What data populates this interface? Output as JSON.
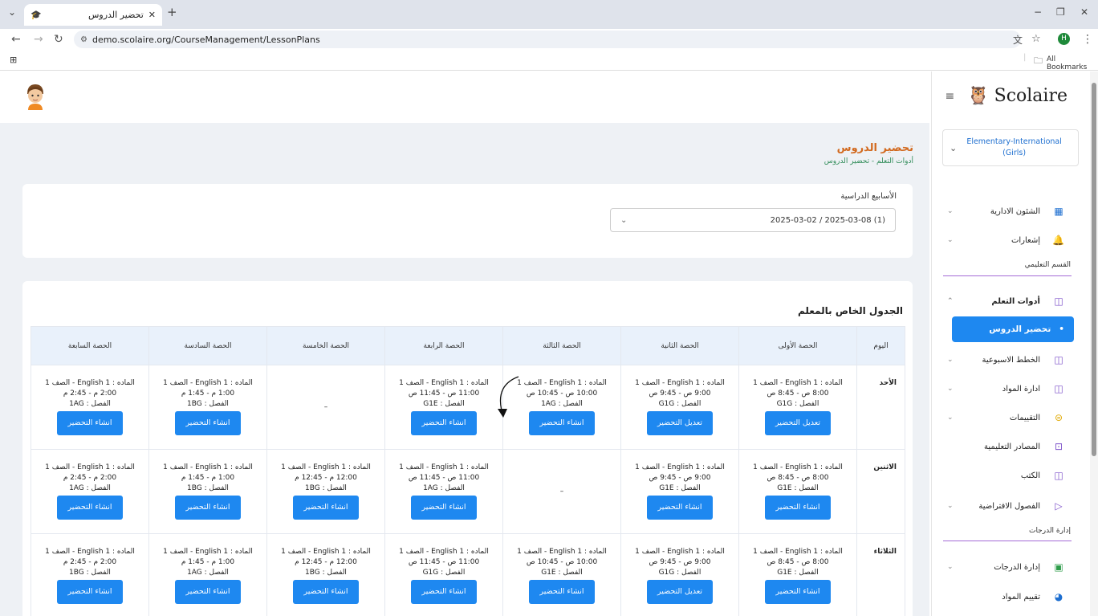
{
  "browser": {
    "tab_title": "تحضير الدروس",
    "url": "demo.scolaire.org/CourseManagement/LessonPlans",
    "all_bookmarks": "All Bookmarks",
    "profile_letter": "H"
  },
  "page": {
    "title": "تحضير الدروس",
    "breadcrumb": "أدوات التعلم  -  تحضير الدروس"
  },
  "weeks": {
    "label": "الأسابيع الدراسية",
    "selected": "(1) 2025-03-08 / 2025-03-02"
  },
  "schedule": {
    "title": "الجدول الخاص بالمعلم",
    "headers": [
      "اليوم",
      "الحصة الأولى",
      "الحصة الثانية",
      "الحصة الثالثة",
      "الحصة الرابعة",
      "الحصة الخامسة",
      "الحصة السادسة",
      "الحصة السابعة"
    ],
    "rows": [
      {
        "day": "الأحد",
        "cells": [
          {
            "subject": "الماده : English 1 - الصف 1",
            "time": "8:00 ص - 8:45 ص",
            "class": "الفصل : G1G",
            "button": "تعديل التحضير"
          },
          {
            "subject": "الماده : English 1 - الصف 1",
            "time": "9:00 ص - 9:45 ص",
            "class": "الفصل : G1G",
            "button": "تعديل التحضير"
          },
          {
            "subject": "الماده : English 1 - الصف 1",
            "time": "10:00 ص - 10:45 ص",
            "class": "الفصل : 1AG",
            "button": "انشاء التحضير"
          },
          {
            "subject": "الماده : English 1 - الصف 1",
            "time": "11:00 ص - 11:45 ص",
            "class": "الفصل : G1E",
            "button": "انشاء التحضير"
          },
          {
            "empty": "–"
          },
          {
            "subject": "الماده : English 1 - الصف 1",
            "time": "1:00 م - 1:45 م",
            "class": "الفصل : 1BG",
            "button": "انشاء التحضير"
          },
          {
            "subject": "الماده : English 1 - الصف 1",
            "time": "2:00 م - 2:45 م",
            "class": "الفصل : 1AG",
            "button": "انشاء التحضير"
          }
        ]
      },
      {
        "day": "الاثنين",
        "cells": [
          {
            "subject": "الماده : English 1 - الصف 1",
            "time": "8:00 ص - 8:45 ص",
            "class": "الفصل : G1E",
            "button": "انشاء التحضير"
          },
          {
            "subject": "الماده : English 1 - الصف 1",
            "time": "9:00 ص - 9:45 ص",
            "class": "الفصل : G1E",
            "button": "انشاء التحضير"
          },
          {
            "empty": "–"
          },
          {
            "subject": "الماده : English 1 - الصف 1",
            "time": "11:00 ص - 11:45 ص",
            "class": "الفصل : 1AG",
            "button": "انشاء التحضير"
          },
          {
            "subject": "الماده : English 1 - الصف 1",
            "time": "12:00 م - 12:45 م",
            "class": "الفصل : 1BG",
            "button": "انشاء التحضير"
          },
          {
            "subject": "الماده : English 1 - الصف 1",
            "time": "1:00 م - 1:45 م",
            "class": "الفصل : 1BG",
            "button": "انشاء التحضير"
          },
          {
            "subject": "الماده : English 1 - الصف 1",
            "time": "2:00 م - 2:45 م",
            "class": "الفصل : 1AG",
            "button": "انشاء التحضير"
          }
        ]
      },
      {
        "day": "الثلاثاء",
        "cells": [
          {
            "subject": "الماده : English 1 - الصف 1",
            "time": "8:00 ص - 8:45 ص",
            "class": "الفصل : G1E",
            "button": "انشاء التحضير"
          },
          {
            "subject": "الماده : English 1 - الصف 1",
            "time": "9:00 ص - 9:45 ص",
            "class": "الفصل : G1G",
            "button": "تعديل التحضير"
          },
          {
            "subject": "الماده : English 1 - الصف 1",
            "time": "10:00 ص - 10:45 ص",
            "class": "الفصل : G1E",
            "button": "انشاء التحضير"
          },
          {
            "subject": "الماده : English 1 - الصف 1",
            "time": "11:00 ص - 11:45 ص",
            "class": "الفصل : G1G",
            "button": "انشاء التحضير"
          },
          {
            "subject": "الماده : English 1 - الصف 1",
            "time": "12:00 م - 12:45 م",
            "class": "الفصل : 1BG",
            "button": "انشاء التحضير"
          },
          {
            "subject": "الماده : English 1 - الصف 1",
            "time": "1:00 م - 1:45 م",
            "class": "الفصل : 1AG",
            "button": "انشاء التحضير"
          },
          {
            "subject": "الماده : English 1 - الصف 1",
            "time": "2:00 م - 2:45 م",
            "class": "الفصل : 1BG",
            "button": "انشاء التحضير"
          }
        ]
      }
    ]
  },
  "sidebar": {
    "brand": "Scolaire",
    "school_line1": "Elementary-International",
    "school_line2": "(Girls)",
    "admin": "الشئون الادارية",
    "notifications": "إشعارات",
    "section_education": "القسم التعليمي",
    "learning_tools": "أدوات التعلم",
    "lesson_plans": "تحضير الدروس",
    "weekly_plans": "الخطط الاسبوعية",
    "subjects": "ادارة المواد",
    "assessments": "التقييمات",
    "resources": "المصادر التعليمية",
    "books": "الكتب",
    "virtual_classes": "الفصول الافتراضية",
    "section_grades": "إدارة الدرجات",
    "grades": "إدارة الدرجات",
    "subject_evaluation": "تقييم المواد"
  }
}
